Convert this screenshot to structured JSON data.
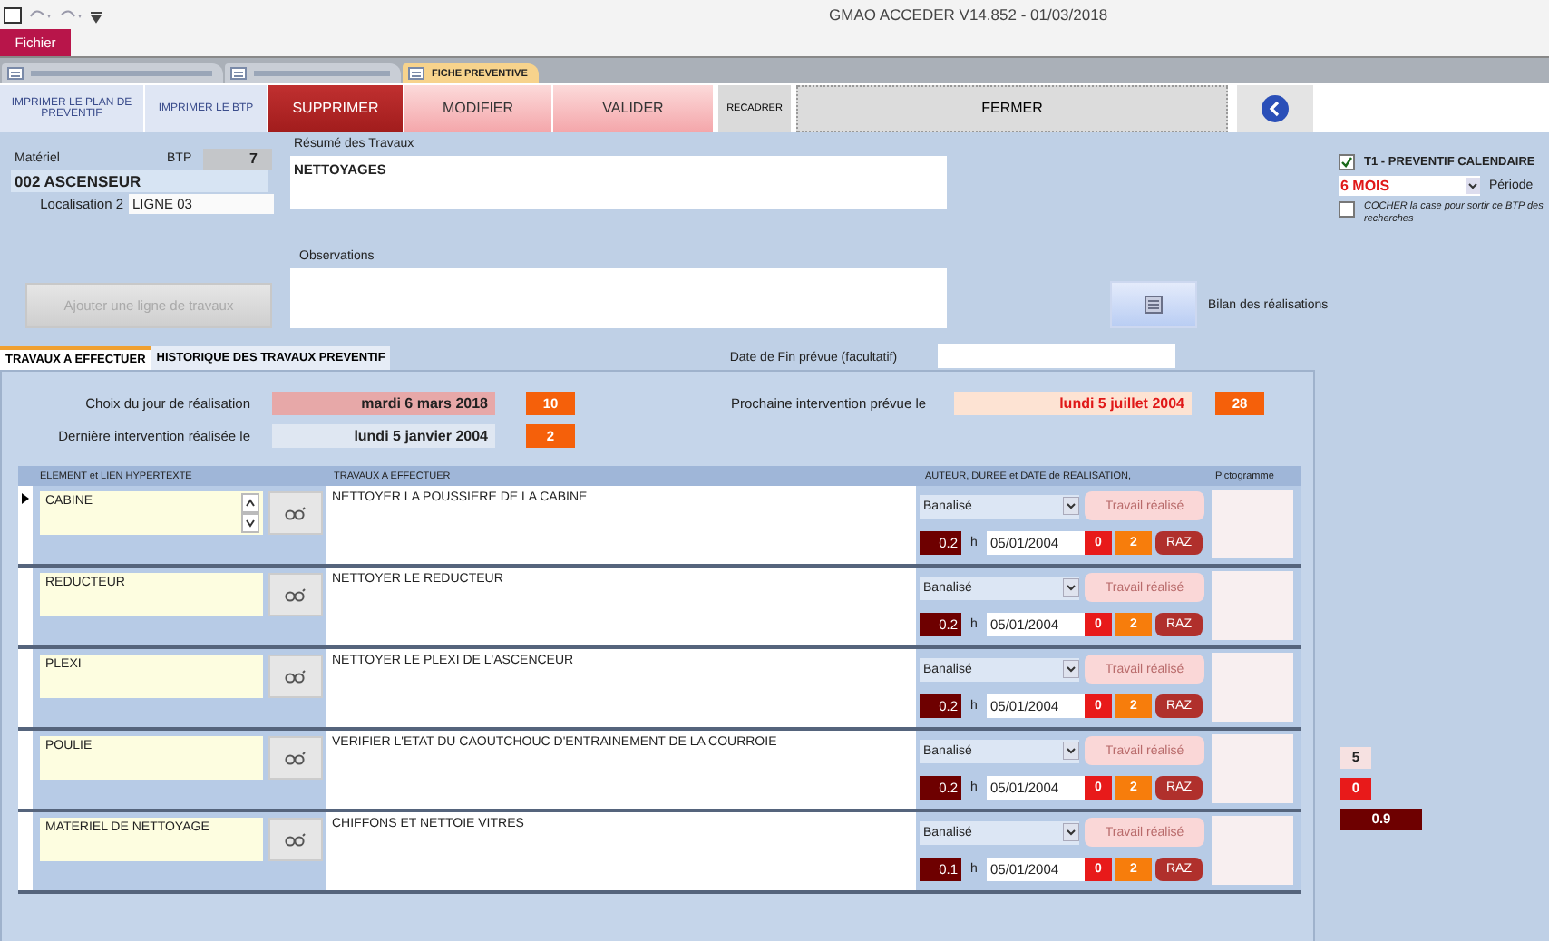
{
  "title": "GMAO ACCEDER V14.852 - 01/03/2018",
  "file_tab": "Fichier",
  "doc_tabs": [
    {
      "selected": false
    },
    {
      "selected": false
    },
    {
      "label": "FICHE PREVENTIVE",
      "selected": true
    }
  ],
  "toolbar": [
    {
      "label": "IMPRIMER LE PLAN DE PREVENTIF",
      "kind": "plain"
    },
    {
      "label": "IMPRIMER LE BTP",
      "kind": "plain"
    },
    {
      "label": "SUPPRIMER",
      "kind": "danger"
    },
    {
      "label": "MODIFIER",
      "kind": "pink"
    },
    {
      "label": "VALIDER",
      "kind": "pink"
    },
    {
      "label": "RECADRER",
      "kind": "gray"
    },
    {
      "label": "FERMER",
      "kind": "wide"
    },
    {
      "kind": "back"
    }
  ],
  "materiel": {
    "label": "Matériel",
    "btp_label": "BTP",
    "btp": "7",
    "name": "002 ASCENSEUR",
    "loc_label": "Localisation 2",
    "loc": "LIGNE 03"
  },
  "resume": {
    "label": "Résumé des Travaux",
    "value": "NETTOYAGES"
  },
  "observations": {
    "label": "Observations"
  },
  "add_button": {
    "label": "Ajouter une ligne de travaux",
    "disabled": true
  },
  "bilan": {
    "label": "Bilan des réalisations"
  },
  "settings": {
    "calendar": {
      "label": "T1 - PREVENTIF CALENDAIRE",
      "checked": true
    },
    "period": {
      "value": "6 MOIS",
      "label": "Période"
    },
    "exclude": {
      "label": "COCHER la case pour sortir ce BTP des recherches",
      "checked": false
    }
  },
  "date_fin": {
    "label": "Date de Fin prévue (facultatif)"
  },
  "tabs": [
    {
      "label": "TRAVAUX  A EFFECTUER",
      "selected": true
    },
    {
      "label": "HISTORIQUE DES TRAVAUX PREVENTIF",
      "selected": false
    }
  ],
  "choix": {
    "label": "Choix du jour de réalisation",
    "value": "mardi 6 mars 2018",
    "count": "10"
  },
  "derniere": {
    "label": "Dernière intervention réalisée le",
    "value": "lundi 5 janvier 2004",
    "count": "2"
  },
  "prochaine": {
    "label": "Prochaine intervention prévue le",
    "value": "lundi 5 juillet 2004",
    "count": "28"
  },
  "table": {
    "columns": [
      "ELEMENT et LIEN HYPERTEXTE",
      "TRAVAUX A EFFECTUER",
      "AUTEUR, DUREE et DATE de REALISATION,",
      "Pictogramme"
    ],
    "rows": [
      {
        "current": true,
        "spinner": true,
        "element": "CABINE",
        "travaux": "NETTOYER LA POUSSIERE DE LA CABINE",
        "auteur": "Banalisé",
        "action": "Travail réalisé",
        "duree": "0.2",
        "unit": "h",
        "date": "05/01/2004",
        "c1": "0",
        "c2": "2",
        "reset": "RAZ"
      },
      {
        "current": false,
        "spinner": false,
        "element": "REDUCTEUR",
        "travaux": "NETTOYER LE REDUCTEUR",
        "auteur": "Banalisé",
        "action": "Travail réalisé",
        "duree": "0.2",
        "unit": "h",
        "date": "05/01/2004",
        "c1": "0",
        "c2": "2",
        "reset": "RAZ"
      },
      {
        "current": false,
        "spinner": false,
        "element": "PLEXI",
        "travaux": "NETTOYER LE PLEXI DE L'ASCENCEUR",
        "auteur": "Banalisé",
        "action": "Travail réalisé",
        "duree": "0.2",
        "unit": "h",
        "date": "05/01/2004",
        "c1": "0",
        "c2": "2",
        "reset": "RAZ"
      },
      {
        "current": false,
        "spinner": false,
        "element": "POULIE",
        "travaux": "VERIFIER L'ETAT DU CAOUTCHOUC D'ENTRAINEMENT DE LA COURROIE",
        "auteur": "Banalisé",
        "action": "Travail réalisé",
        "duree": "0.2",
        "unit": "h",
        "date": "05/01/2004",
        "c1": "0",
        "c2": "2",
        "reset": "RAZ"
      },
      {
        "current": false,
        "spinner": false,
        "element": "MATERIEL DE NETTOYAGE",
        "travaux": "CHIFFONS ET NETTOIE VITRES",
        "auteur": "Banalisé",
        "action": "Travail réalisé",
        "duree": "0.1",
        "unit": "h",
        "date": "05/01/2004",
        "c1": "0",
        "c2": "2",
        "reset": "RAZ"
      }
    ]
  },
  "totals": [
    {
      "kind": "count",
      "value": "5"
    },
    {
      "kind": "zero",
      "value": "0"
    },
    {
      "kind": "hours",
      "value": "0.9"
    }
  ]
}
